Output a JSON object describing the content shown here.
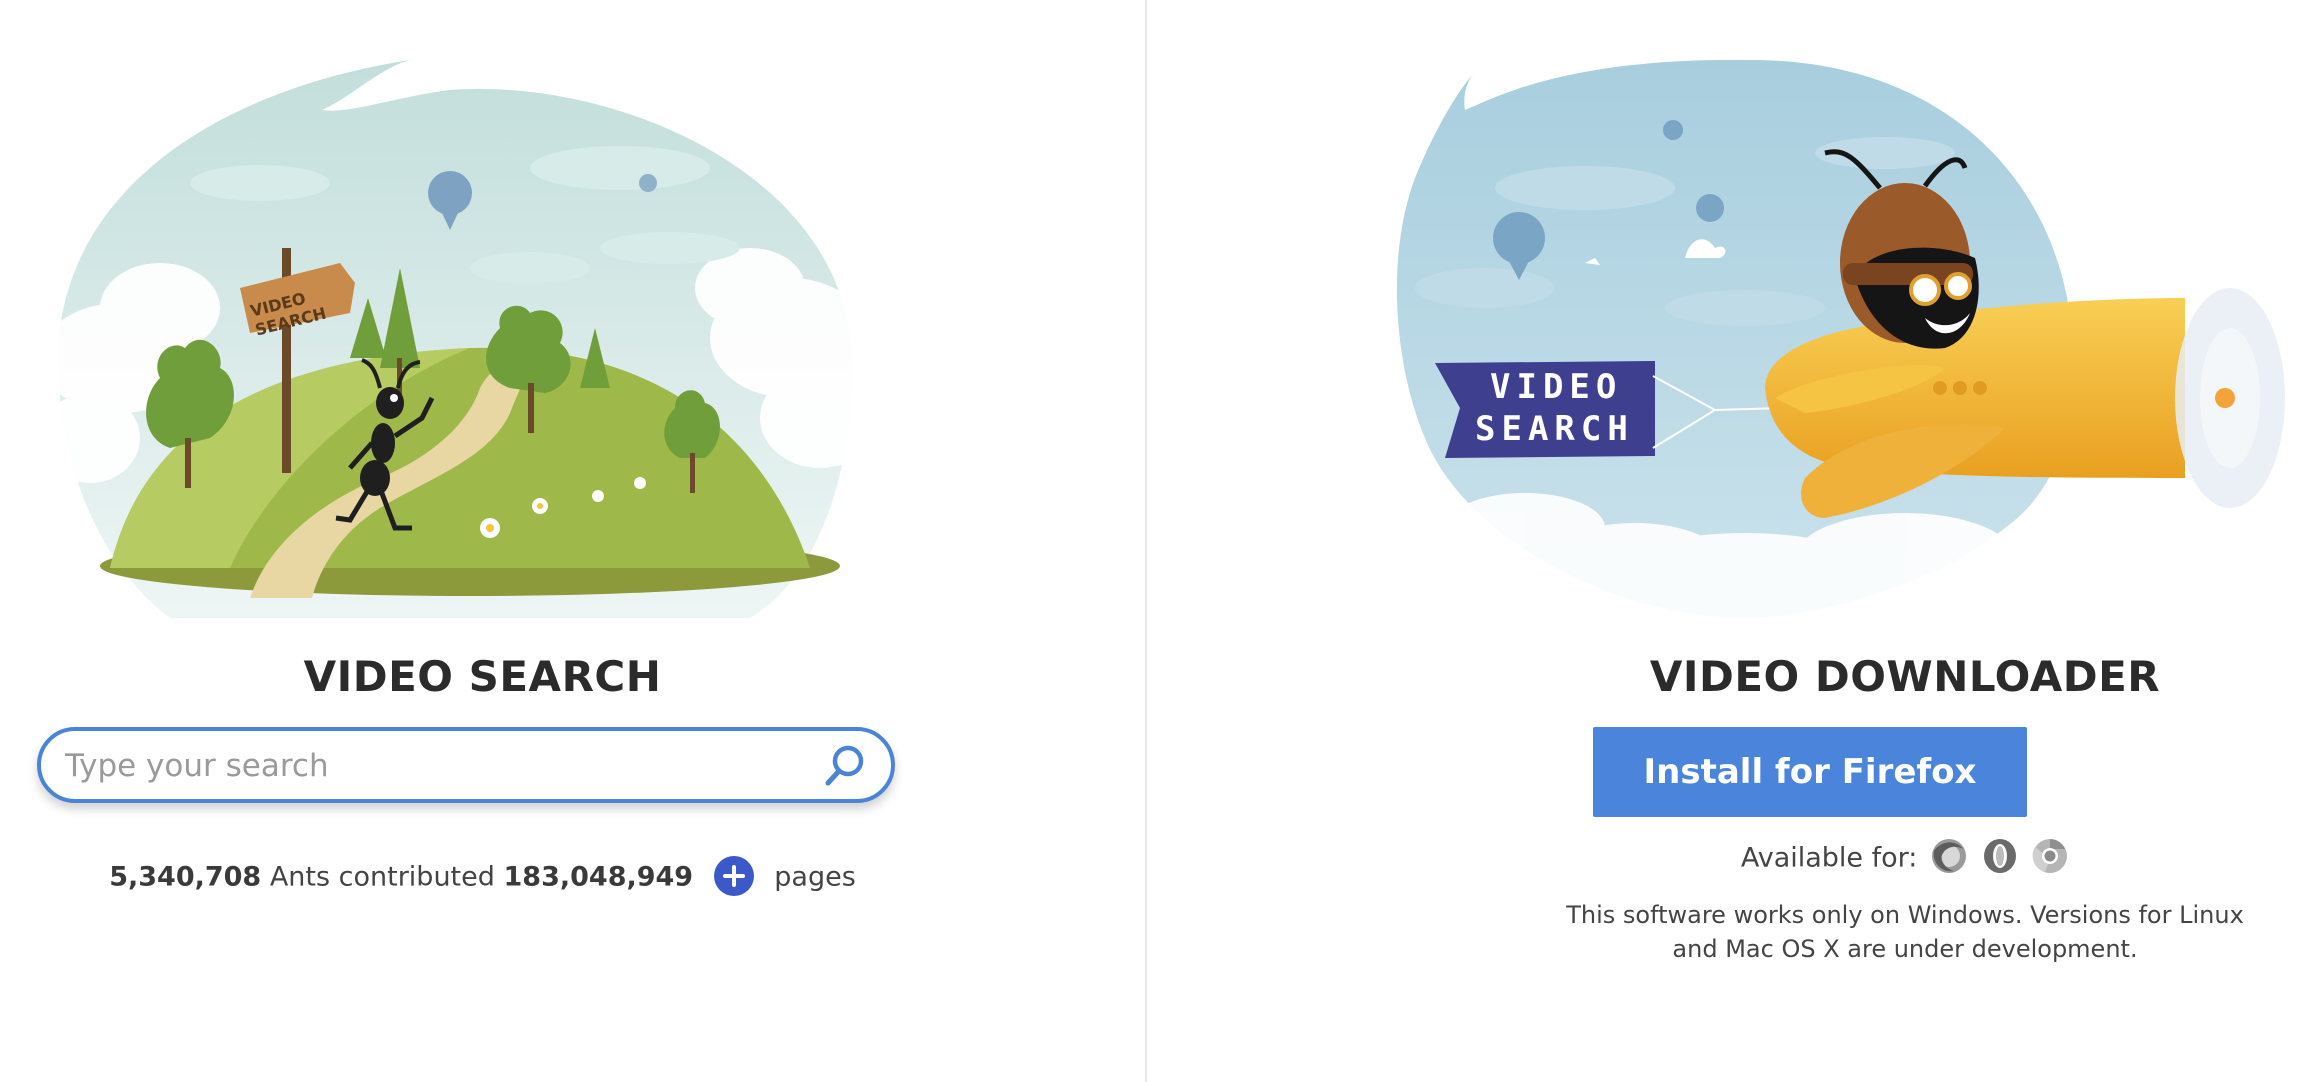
{
  "search_section": {
    "title": "VIDEO SEARCH",
    "search_placeholder": "Type your search",
    "stats": {
      "ants_count": "5,340,708",
      "ants_label": "Ants contributed",
      "pages_count": "183,048,949",
      "pages_label": "pages"
    },
    "illustration_sign_text": "VIDEO SEARCH",
    "icons": [
      "search-icon",
      "plus-icon"
    ]
  },
  "downloader_section": {
    "title": "VIDEO DOWNLOADER",
    "install_label": "Install for Firefox",
    "available_label": "Available for:",
    "browsers": [
      "firefox-icon",
      "opera-icon",
      "chrome-icon"
    ],
    "note_line1": "This software works only on Windows. Versions for Linux",
    "note_line2": "and Mac OS X are under development.",
    "illustration_banner_text": "VIDEO SEARCH"
  },
  "colors": {
    "accent": "#4a84db",
    "search_border": "#4a84d8",
    "plus_button": "#3d58c8",
    "banner": "#3f3f8f",
    "plane": "#f2b635"
  }
}
